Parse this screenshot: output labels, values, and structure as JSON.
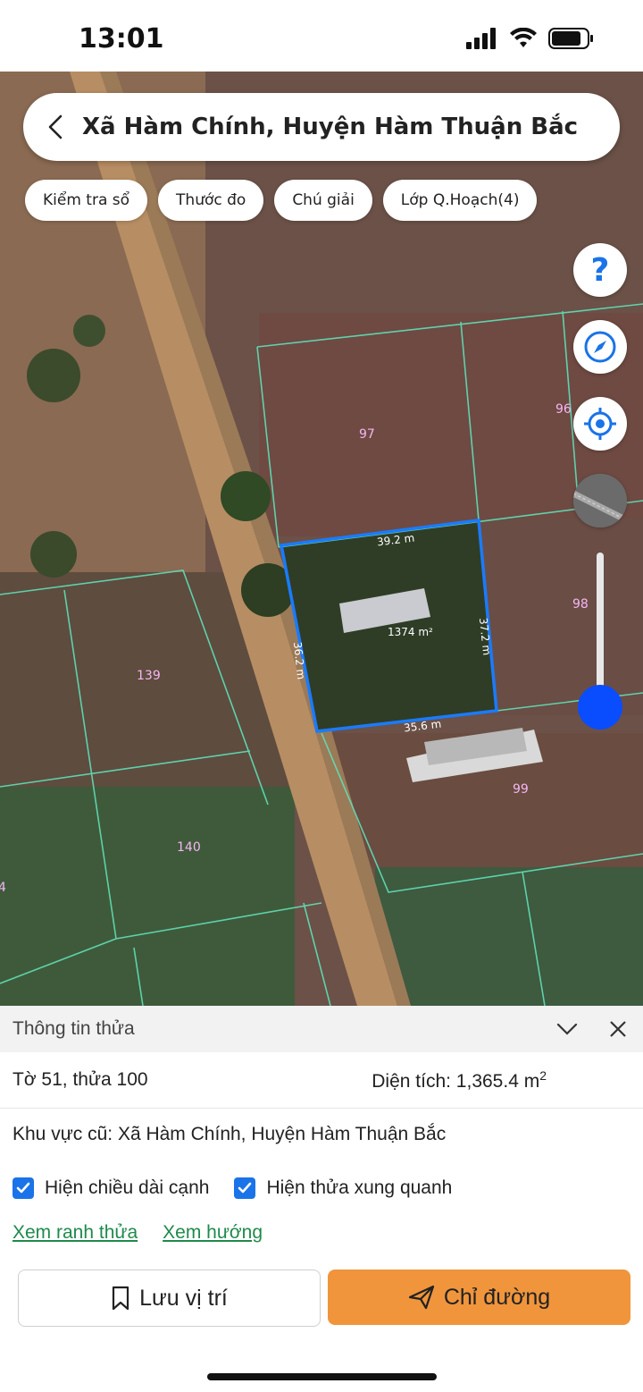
{
  "status": {
    "time": "13:01"
  },
  "header": {
    "title": "Xã Hàm Chính, Huyện Hàm Thuận Bắc"
  },
  "chips": [
    {
      "label": "Kiểm tra sổ"
    },
    {
      "label": "Thước đo"
    },
    {
      "label": "Chú giải"
    },
    {
      "label": "Lớp Q.Hoạch(4)"
    }
  ],
  "map": {
    "parcels": [
      "97",
      "96",
      "98",
      "99",
      "139",
      "140",
      "4"
    ],
    "edges": [
      "39.2 m",
      "37.2 m",
      "35.6 m",
      "36.2 m"
    ],
    "area_label": "1374 m²"
  },
  "side_buttons": [
    "help-icon",
    "compass-icon",
    "locate-icon",
    "layer-thumbnail"
  ],
  "zoom_level": 0.17,
  "panel": {
    "title": "Thông tin thửa",
    "parcel_id": "Tờ 51, thửa 100",
    "area_prefix": "Diện tích: 1,365.4 m",
    "area_sup": "2",
    "old_region": "Khu vực cũ: Xã Hàm Chính, Huyện Hàm Thuận Bắc",
    "check_edges": "Hiện chiều dài cạnh",
    "check_neighbors": "Hiện thửa xung quanh",
    "link_boundary": "Xem ranh thửa",
    "link_direction": "Xem hướng",
    "save_label": "Lưu vị trí",
    "route_label": "Chỉ đường"
  },
  "colors": {
    "accent": "#f0953c",
    "selected_parcel": "#1a7bff",
    "parcel_lines": "#5fe0b8",
    "link": "#1f8a4c",
    "checkbox": "#1a73e8"
  }
}
